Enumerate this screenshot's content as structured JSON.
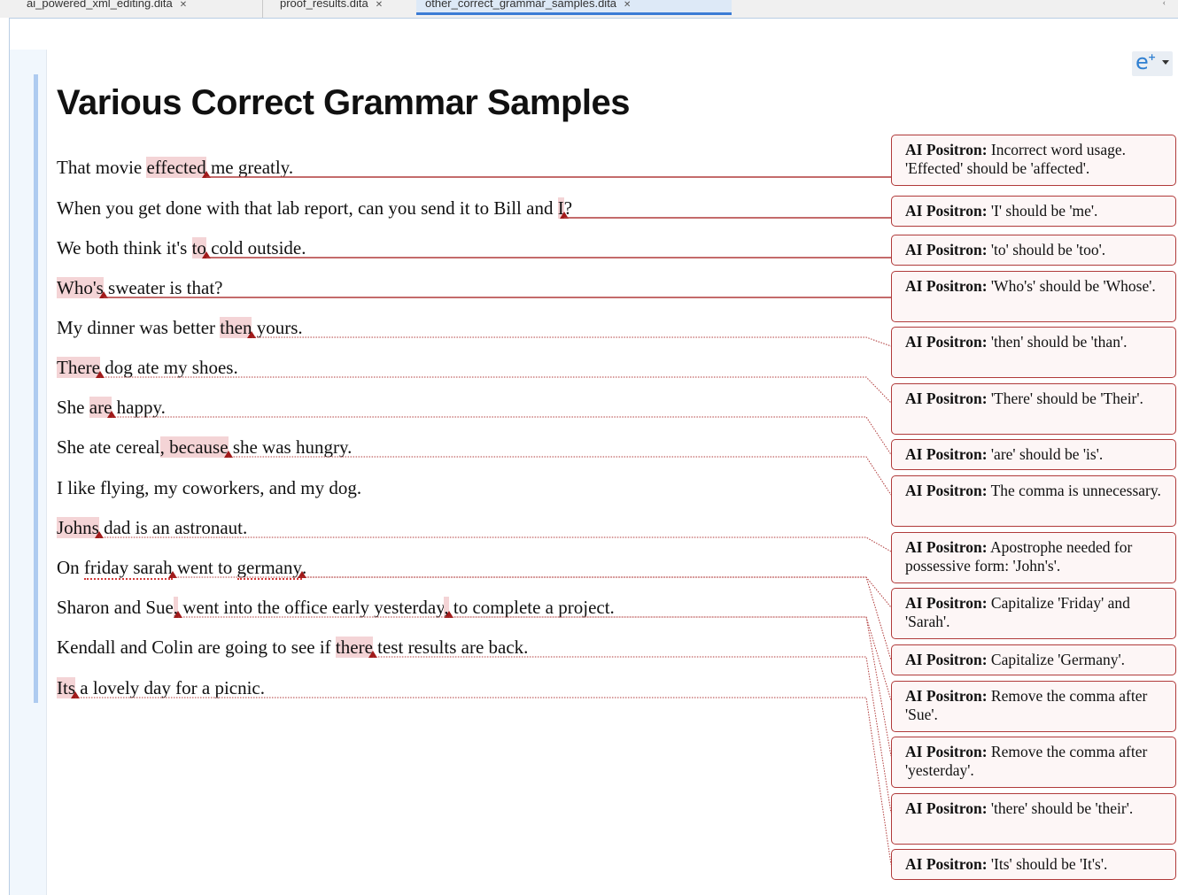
{
  "tabs": [
    {
      "label": "ai_powered_xml_editing.dita"
    },
    {
      "label": "proof_results.dita"
    },
    {
      "label": "other_correct_grammar_samples.dita",
      "active": true
    }
  ],
  "toolbar": {
    "assist_icon": "e-plus-icon"
  },
  "document": {
    "title": "Various Correct Grammar Samples",
    "lines": [
      {
        "segments": [
          {
            "t": "That movie "
          },
          {
            "t": "effected",
            "hl": true
          },
          {
            "t": "▲",
            "mark": true
          },
          {
            "t": " me greatly."
          }
        ]
      },
      {
        "segments": [
          {
            "t": "When you get done with that lab report, can you send it to Bill and "
          },
          {
            "t": "I",
            "hl": true
          },
          {
            "t": "▲",
            "mark": true
          },
          {
            "t": "?"
          }
        ]
      },
      {
        "segments": [
          {
            "t": "We both think it's "
          },
          {
            "t": "to",
            "hl": true
          },
          {
            "t": "▲",
            "mark": true
          },
          {
            "t": " cold outside."
          }
        ]
      },
      {
        "segments": [
          {
            "t": "Who's",
            "hl": true
          },
          {
            "t": "▲",
            "mark": true
          },
          {
            "t": " sweater is that?"
          }
        ]
      },
      {
        "segments": [
          {
            "t": "My dinner was better "
          },
          {
            "t": "then",
            "hl": true
          },
          {
            "t": "▲",
            "mark": true
          },
          {
            "t": " yours."
          }
        ]
      },
      {
        "segments": [
          {
            "t": "There",
            "hl": true
          },
          {
            "t": "▲",
            "mark": true
          },
          {
            "t": " dog ate my shoes."
          }
        ]
      },
      {
        "segments": [
          {
            "t": "She "
          },
          {
            "t": "are",
            "hl": true
          },
          {
            "t": "▲",
            "mark": true
          },
          {
            "t": " happy."
          }
        ]
      },
      {
        "segments": [
          {
            "t": "She ate cereal"
          },
          {
            "t": ", because",
            "hl": true
          },
          {
            "t": "▲",
            "mark": true
          },
          {
            "t": " she was hungry."
          }
        ]
      },
      {
        "segments": [
          {
            "t": "I like flying, my coworkers, and my dog."
          }
        ]
      },
      {
        "segments": [
          {
            "t": "Johns",
            "hl": true
          },
          {
            "t": "▲",
            "mark": true
          },
          {
            "t": " dad is an astronaut."
          }
        ]
      },
      {
        "segments": [
          {
            "t": "On "
          },
          {
            "t": "friday sarah",
            "dotted": true
          },
          {
            "t": "▲",
            "mark": true
          },
          {
            "t": " went to "
          },
          {
            "t": "germany",
            "dotted": true
          },
          {
            "t": "▲",
            "mark": true
          },
          {
            "t": "."
          }
        ]
      },
      {
        "segments": [
          {
            "t": "Sharon and Sue"
          },
          {
            "t": ",",
            "hl": true
          },
          {
            "t": "▲",
            "mark": true
          },
          {
            "t": " went into the office early yesterday"
          },
          {
            "t": ",",
            "hl": true
          },
          {
            "t": "▲",
            "mark": true
          },
          {
            "t": " to complete a project."
          }
        ]
      },
      {
        "segments": [
          {
            "t": "Kendall and Colin are going to see if "
          },
          {
            "t": "there",
            "hl": true
          },
          {
            "t": "▲",
            "mark": true
          },
          {
            "t": " test results are back."
          }
        ]
      },
      {
        "segments": [
          {
            "t": "Its",
            "hl": true
          },
          {
            "t": "▲",
            "mark": true
          },
          {
            "t": " a lovely day for a picnic."
          }
        ]
      }
    ]
  },
  "comments": [
    {
      "author": "AI Positron:",
      "text": " Incorrect word usage. 'Effected' should be 'affected'."
    },
    {
      "author": "AI Positron:",
      "text": " 'I' should be 'me'."
    },
    {
      "author": "AI Positron:",
      "text": " 'to' should be 'too'."
    },
    {
      "author": "AI Positron:",
      "text": " 'Who's' should be 'Whose'."
    },
    {
      "author": "AI Positron:",
      "text": " 'then' should be 'than'."
    },
    {
      "author": "AI Positron:",
      "text": " 'There' should be 'Their'."
    },
    {
      "author": "AI Positron:",
      "text": " 'are' should be 'is'."
    },
    {
      "author": "AI Positron:",
      "text": " The comma is unnecessary."
    },
    {
      "author": "AI Positron:",
      "text": " Apostrophe needed for possessive form: 'John's'."
    },
    {
      "author": "AI Positron:",
      "text": " Capitalize 'Friday' and 'Sarah'."
    },
    {
      "author": "AI Positron:",
      "text": " Capitalize 'Germany'."
    },
    {
      "author": "AI Positron:",
      "text": " Remove the comma after 'Sue'."
    },
    {
      "author": "AI Positron:",
      "text": " Remove the comma after 'yesterday'."
    },
    {
      "author": "AI Positron:",
      "text": " 'there' should be 'their'."
    },
    {
      "author": "AI Positron:",
      "text": " 'Its' should be 'It's'."
    }
  ],
  "colors": {
    "highlight": "#f4d4d6",
    "marker": "#a01a1a",
    "comment_border": "#b03a3a",
    "leader": "#b03a3a"
  }
}
